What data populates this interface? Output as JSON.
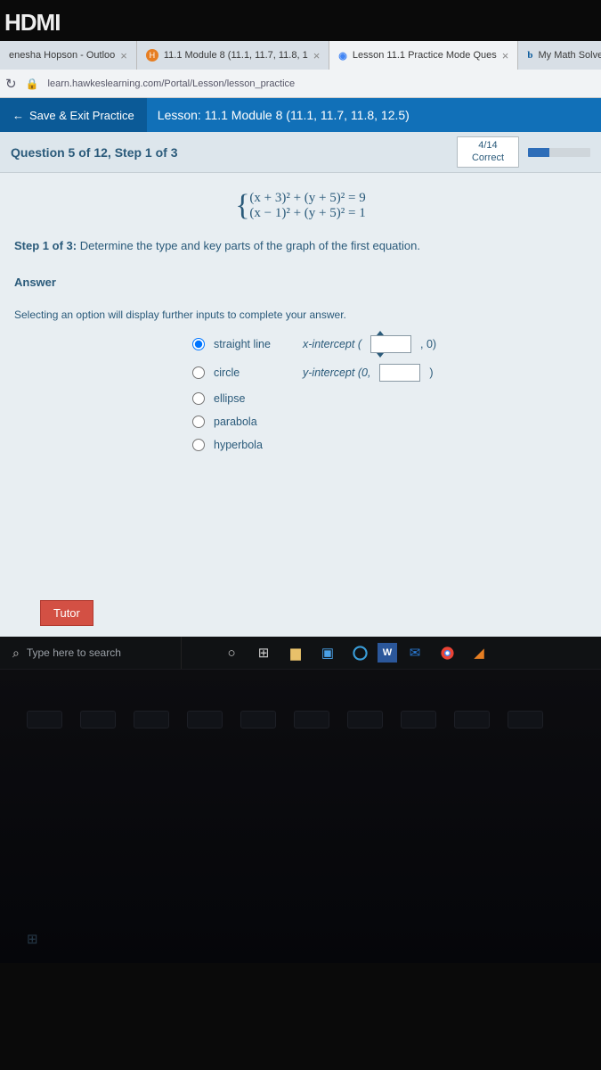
{
  "monitor": {
    "logo": "HDMI"
  },
  "browser": {
    "tabs": [
      {
        "title": "enesha Hopson - Outloo",
        "favicon": "o"
      },
      {
        "title": "11.1 Module 8 (11.1, 11.7, 11.8, 1",
        "favicon": "h"
      },
      {
        "title": "Lesson 11.1 Practice Mode Ques",
        "favicon": "g"
      },
      {
        "title": "My Math Solver | bartl",
        "favicon": "b"
      }
    ],
    "url": "learn.hawkeslearning.com/Portal/Lesson/lesson_practice"
  },
  "lesson": {
    "save_exit_label": "Save & Exit Practice",
    "title": "Lesson: 11.1 Module 8 (11.1, 11.7, 11.8, 12.5)"
  },
  "question": {
    "header": "Question 5 of 12, Step 1 of 3",
    "score_fraction": "4/14",
    "score_label": "Correct",
    "progress_pct": 34,
    "equation_1": "(x + 3)² + (y + 5)² = 9",
    "equation_2": "(x − 1)² + (y + 5)² = 1",
    "step_label": "Step 1 of 3:",
    "step_text": "Determine the type and key parts of the graph of the first equation.",
    "answer_label": "Answer",
    "hint_text": "Selecting an option will display further inputs to complete your answer.",
    "options": {
      "straight_line": "straight line",
      "circle": "circle",
      "ellipse": "ellipse",
      "parabola": "parabola",
      "hyperbola": "hyperbola"
    },
    "xintercept_label": "x-intercept (",
    "xintercept_suffix": ", 0)",
    "yintercept_label": "y-intercept (0,",
    "yintercept_suffix": ")",
    "tutor_label": "Tutor"
  },
  "taskbar": {
    "search_placeholder": "Type here to search"
  }
}
